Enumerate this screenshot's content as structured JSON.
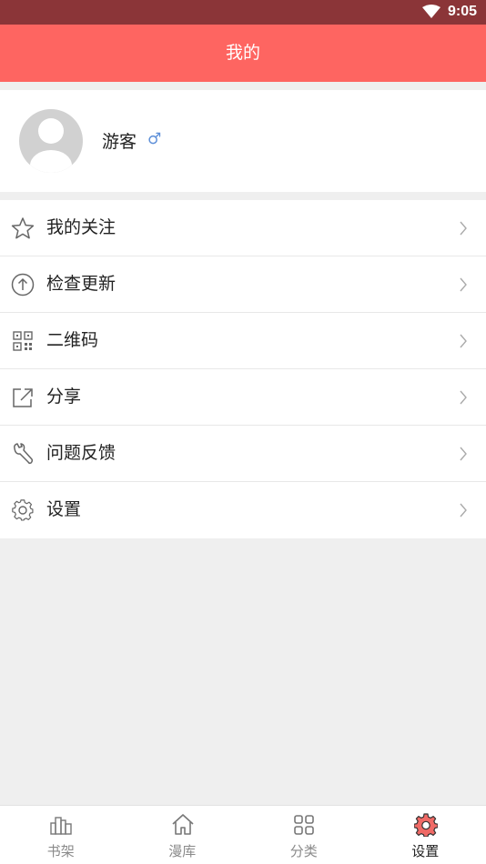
{
  "status_bar": {
    "time": "9:05",
    "wifi_icon": "wifi-icon"
  },
  "header": {
    "title": "我的"
  },
  "profile": {
    "name": "游客",
    "gender_symbol": "♂",
    "avatar_icon": "avatar-placeholder-icon"
  },
  "menu": [
    {
      "icon": "star-icon",
      "label": "我的关注"
    },
    {
      "icon": "upload-circle-icon",
      "label": "检查更新"
    },
    {
      "icon": "qr-code-icon",
      "label": "二维码"
    },
    {
      "icon": "share-icon",
      "label": "分享"
    },
    {
      "icon": "wrench-icon",
      "label": "问题反馈"
    },
    {
      "icon": "gear-icon",
      "label": "设置"
    }
  ],
  "tabs": [
    {
      "icon": "bookshelf-icon",
      "label": "书架"
    },
    {
      "icon": "home-icon",
      "label": "漫库"
    },
    {
      "icon": "grid-icon",
      "label": "分类"
    },
    {
      "icon": "gear-icon",
      "label": "设置",
      "active": true
    }
  ],
  "colors": {
    "accent": "#fe6561",
    "status_bar": "#8b3538",
    "background": "#efefef",
    "gender": "#5d8fd8"
  }
}
